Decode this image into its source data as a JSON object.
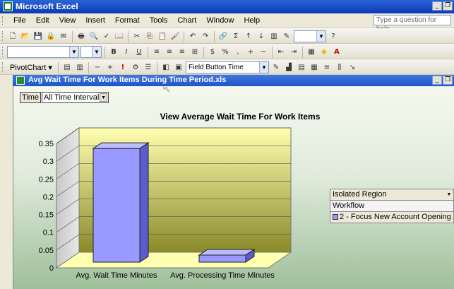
{
  "app": {
    "title": "Microsoft Excel",
    "help_placeholder": "Type a question for help"
  },
  "menu": [
    "File",
    "Edit",
    "View",
    "Insert",
    "Format",
    "Tools",
    "Chart",
    "Window",
    "Help"
  ],
  "toolbar3": {
    "pivotchart_label": "PivotChart ▾",
    "field_button_label": "Field Button Time"
  },
  "workbook": {
    "title": "Avg Wait Time For Work Items During Time Period.xls"
  },
  "page_field": {
    "name": "Time",
    "value": "All Time Interval"
  },
  "legend": {
    "field": "Isolated Region",
    "series_field": "Workflow",
    "series_label": "2 - Focus New Account Opening"
  },
  "colors": {
    "bar": "#9999ff",
    "back_wall_top": "#ffffb0",
    "back_wall_bottom": "#8a8a2a"
  },
  "chart_data": {
    "type": "bar",
    "title": "View Average Wait Time For Work Items",
    "categories": [
      "Avg. Wait Time Minutes",
      "Avg. Processing Time Minutes"
    ],
    "series": [
      {
        "name": "2 - Focus New Account Opening",
        "values": [
          0.32,
          0.02
        ]
      }
    ],
    "ylim": [
      0,
      0.35
    ],
    "yticks": [
      "0",
      "0.05",
      "0.1",
      "0.15",
      "0.2",
      "0.25",
      "0.3",
      "0.35"
    ],
    "grid": true,
    "legend_position": "right"
  }
}
